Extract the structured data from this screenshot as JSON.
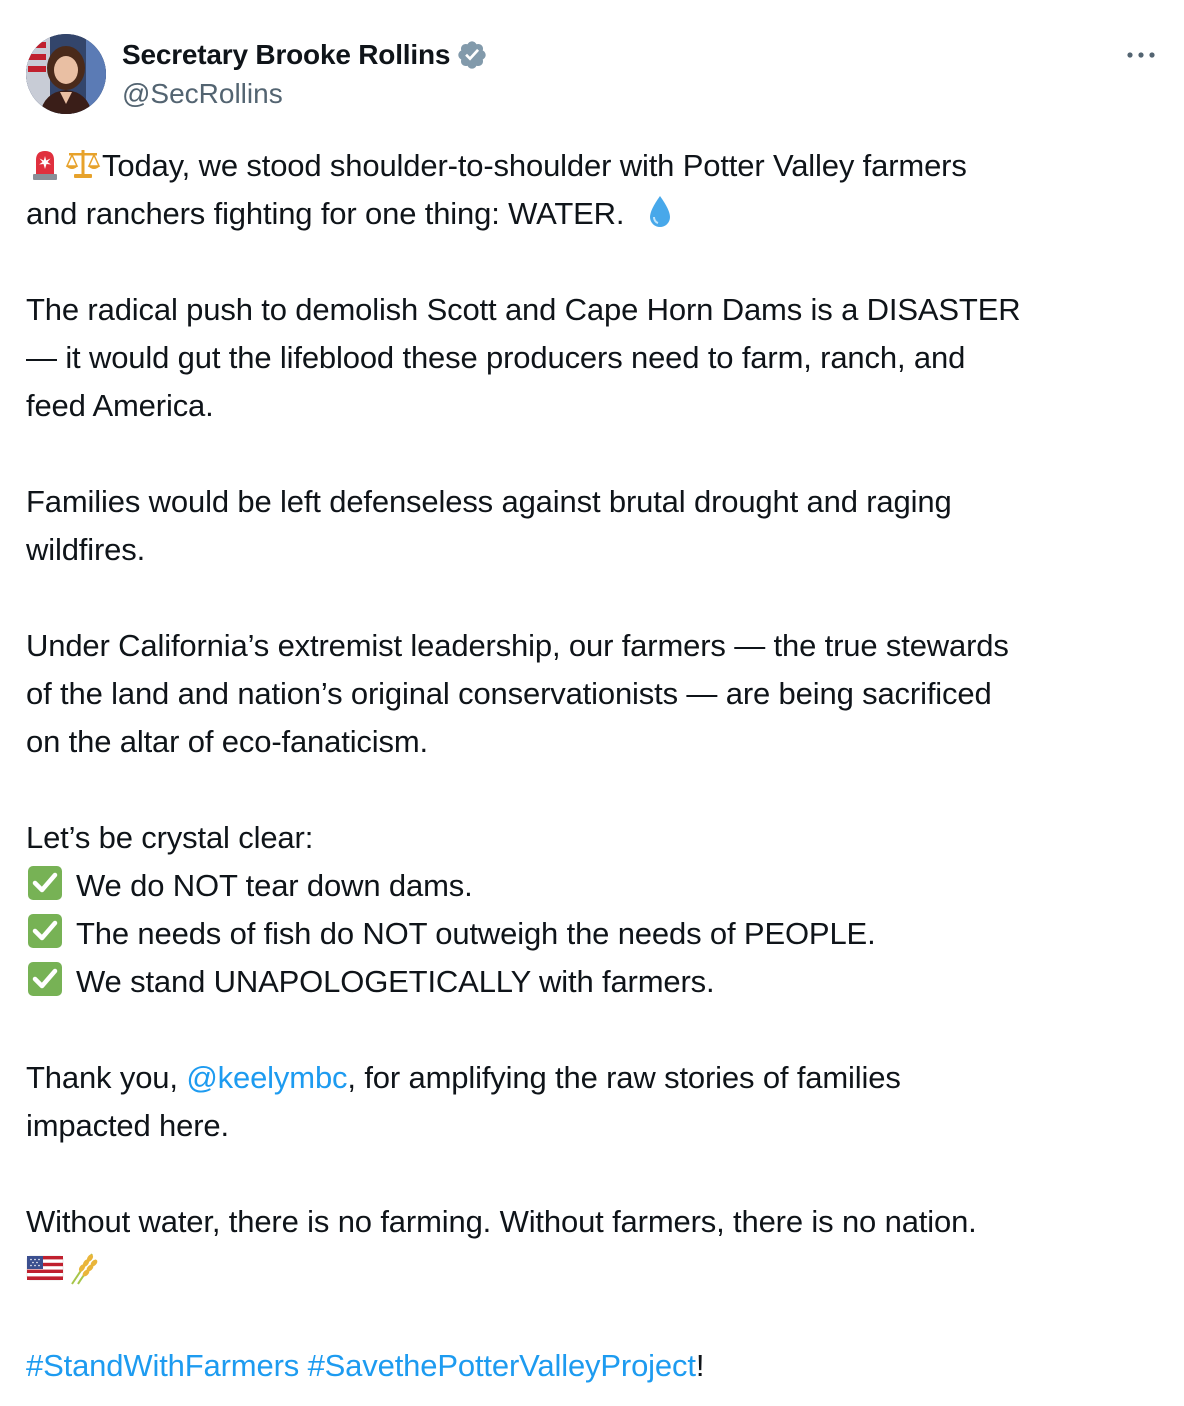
{
  "author": {
    "display_name": "Secretary Brooke Rollins",
    "handle": "@SecRollins",
    "verified_icon": "verified-badge-icon"
  },
  "tweet": {
    "p1_line1": "Today, we stood shoulder-to-shoulder with Potter Valley farmers",
    "p1_line2": "and ranchers fighting for one thing: WATER.",
    "p2_line1": "The radical push to demolish Scott and Cape Horn Dams is a DISASTER",
    "p2_line2": "— it would gut the lifeblood these producers need to farm, ranch, and",
    "p2_line3": "feed America.",
    "p3_line1": "Families would be left defenseless against brutal drought and raging",
    "p3_line2": "wildfires.",
    "p4_line1": "Under California’s extremist leadership, our farmers — the true stewards",
    "p4_line2": "of the land and nation’s original conservationists — are being sacrificed",
    "p4_line3": "on the altar of eco-fanaticism.",
    "p5_line1": "Let’s be crystal clear:",
    "check1": "We do NOT tear down dams.",
    "check2": "The needs of fish do NOT outweigh the needs of PEOPLE.",
    "check3": "We stand UNAPOLOGETICALLY with farmers.",
    "p6_pre": "Thank you, ",
    "p6_mention": "@keelymbc",
    "p6_post": ", for amplifying the raw stories of families",
    "p6_line2": "impacted here.",
    "p7_line1": "Without water, there is no farming. Without farmers, there is no nation.",
    "hashtag1": "#StandWithFarmers",
    "hashtag2": "#SavethePotterValleyProject",
    "closing": "!"
  },
  "colors": {
    "text": "#0f1419",
    "secondary": "#536471",
    "link": "#1d9bf0"
  }
}
